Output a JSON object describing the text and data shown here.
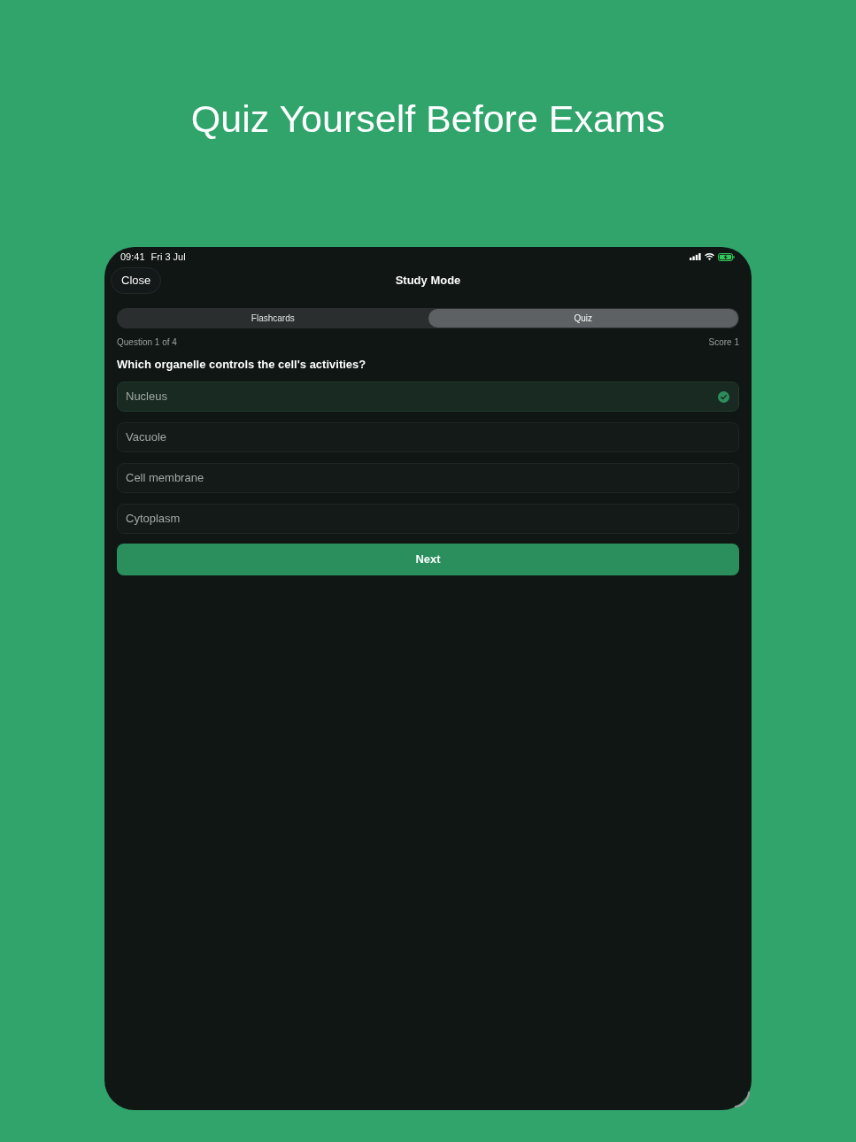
{
  "heading": "Quiz Yourself Before Exams",
  "status_bar": {
    "time": "09:41",
    "date": "Fri 3 Jul"
  },
  "nav": {
    "close_button": "Close",
    "title": "Study Mode"
  },
  "tabs": [
    {
      "label": "Flashcards",
      "selected": false
    },
    {
      "label": "Quiz",
      "selected": true
    }
  ],
  "progress": {
    "question": "Question 1 of 4",
    "score": "Score 1"
  },
  "question": "Which organelle controls the cell's activities?",
  "options": [
    {
      "label": "Nucleus",
      "selected": true
    },
    {
      "label": "Vacuole",
      "selected": false
    },
    {
      "label": "Cell membrane",
      "selected": false
    },
    {
      "label": "Cytoplasm",
      "selected": false
    }
  ],
  "next_button": "Next"
}
